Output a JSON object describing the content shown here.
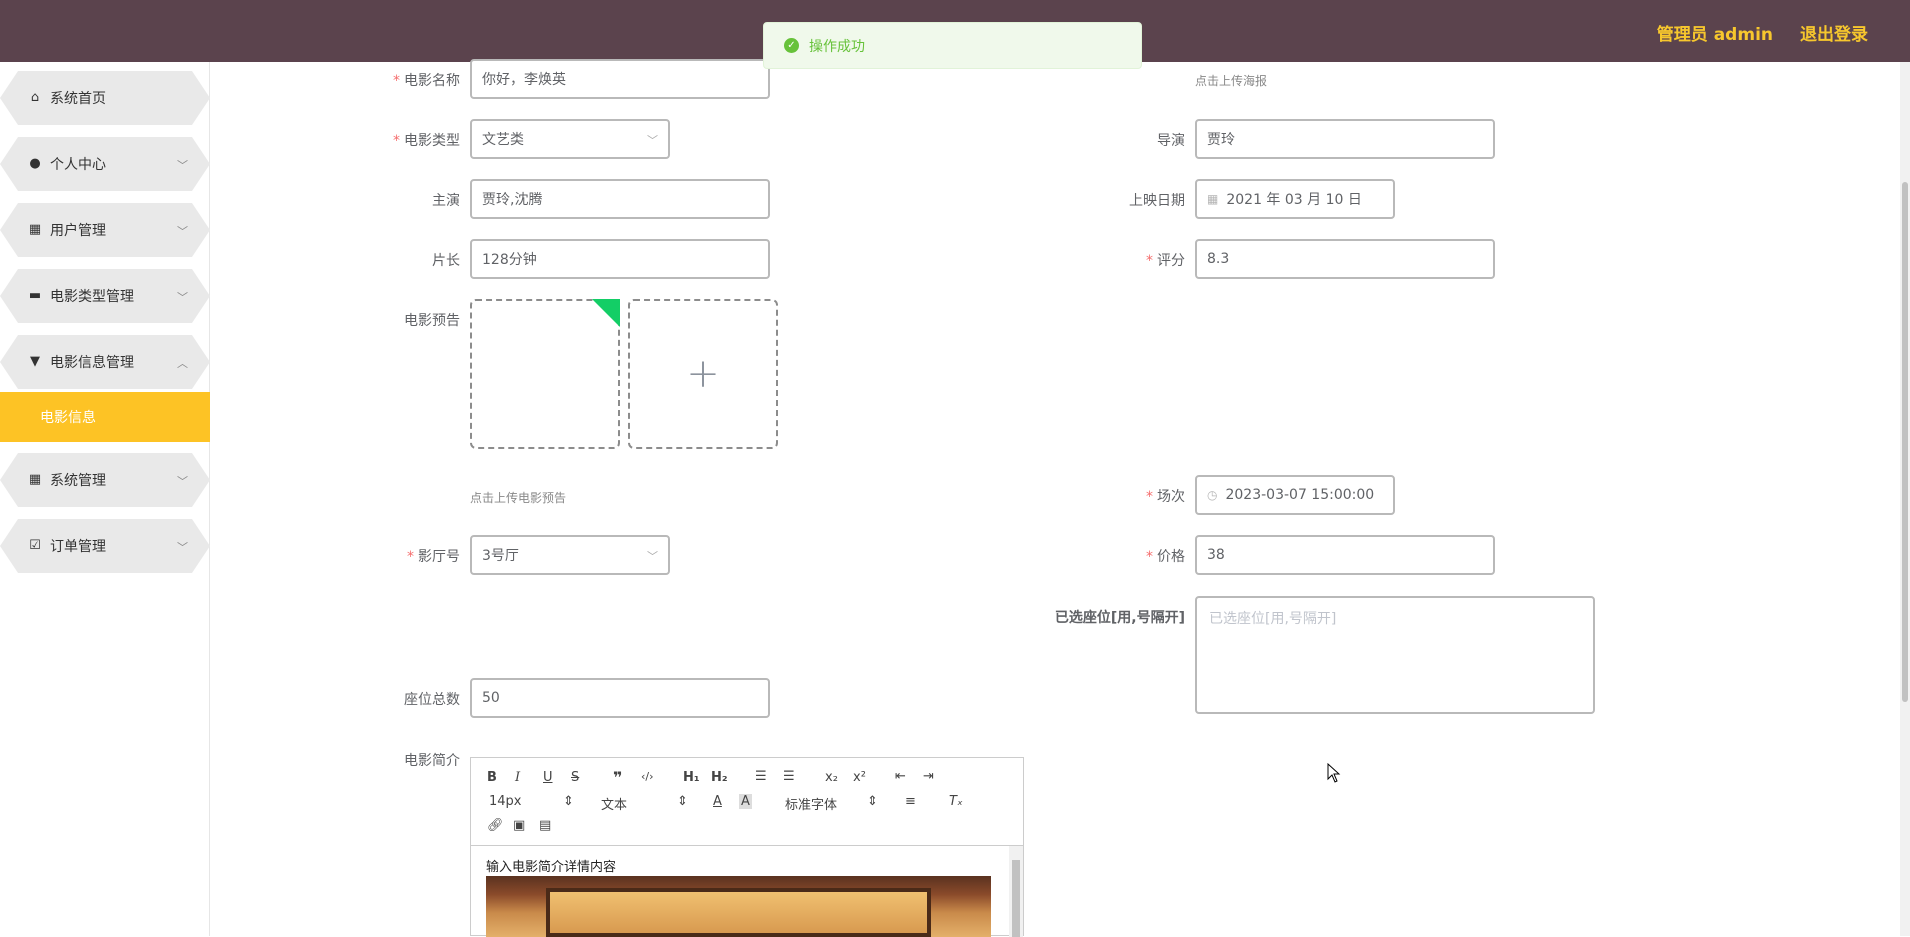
{
  "header": {
    "user_label": "管理员 admin",
    "logout_label": "退出登录"
  },
  "toast": {
    "message": "操作成功"
  },
  "sidebar": {
    "items": [
      {
        "label": "系统首页",
        "icon": "home-icon"
      },
      {
        "label": "个人中心",
        "icon": "user-icon"
      },
      {
        "label": "用户管理",
        "icon": "grid-icon"
      },
      {
        "label": "电影类型管理",
        "icon": "briefcase-icon"
      },
      {
        "label": "电影信息管理",
        "icon": "brush-icon"
      },
      {
        "label": "系统管理",
        "icon": "grid-icon"
      },
      {
        "label": "订单管理",
        "icon": "clipboard-icon"
      }
    ],
    "active_sub": "电影信息"
  },
  "form": {
    "title": {
      "label": "电影名称",
      "value": "你好，李焕英"
    },
    "poster_hint": "点击上传海报",
    "type": {
      "label": "电影类型",
      "value": "文艺类"
    },
    "director": {
      "label": "导演",
      "value": "贾玲"
    },
    "actors": {
      "label": "主演",
      "value": "贾玲,沈腾"
    },
    "release_date": {
      "label": "上映日期",
      "value": "2021 年 03 月 10 日"
    },
    "duration": {
      "label": "片长",
      "value": "128分钟"
    },
    "rating": {
      "label": "评分",
      "value": "8.3"
    },
    "trailer": {
      "label": "电影预告",
      "hint": "点击上传电影预告"
    },
    "showtime": {
      "label": "场次",
      "value": "2023-03-07 15:00:00"
    },
    "hall": {
      "label": "影厅号",
      "value": "3号厅"
    },
    "price": {
      "label": "价格",
      "value": "38"
    },
    "selected_seats": {
      "label": "已选座位[用,号隔开]",
      "placeholder": "已选座位[用,号隔开]"
    },
    "total_seats": {
      "label": "座位总数",
      "value": "50"
    },
    "intro": {
      "label": "电影简介",
      "content": "输入电影简介详情内容"
    }
  },
  "editor": {
    "font_size": "14px",
    "block": "文本",
    "font_family": "标准字体"
  }
}
